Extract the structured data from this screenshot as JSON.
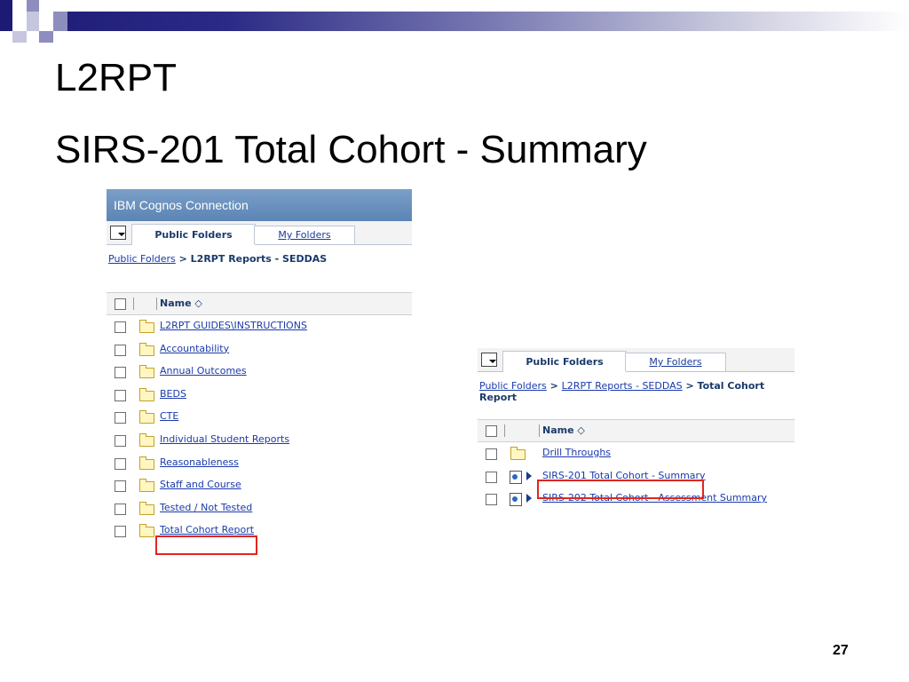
{
  "slide": {
    "title": "L2RPT",
    "subtitle": "SIRS-201 Total Cohort - Summary",
    "page_number": "27"
  },
  "colors": {
    "band_dark": "#1c1a74",
    "link": "#1a3aaa",
    "highlight": "#e0261e"
  },
  "screenshot1": {
    "app_title": "IBM Cognos Connection",
    "tabs": {
      "active": "Public Folders",
      "other": "My Folders"
    },
    "breadcrumb": {
      "link": "Public Folders",
      "separator": " > ",
      "current": "L2RPT Reports - SEDDAS"
    },
    "column_header": "Name ◇",
    "items": [
      "L2RPT GUIDES\\INSTRUCTIONS",
      "Accountability",
      "Annual Outcomes",
      "BEDS",
      "CTE",
      "Individual Student Reports",
      "Reasonableness",
      "Staff and Course",
      "Tested / Not Tested",
      "Total Cohort Report"
    ]
  },
  "screenshot2": {
    "tabs": {
      "active": "Public Folders",
      "other": "My Folders"
    },
    "breadcrumb": {
      "link1": "Public Folders",
      "separator": " > ",
      "link2": "L2RPT Reports - SEDDAS",
      "current": "Total Cohort Report"
    },
    "column_header": "Name ◇",
    "items": [
      "Drill Throughs",
      "SIRS-201 Total Cohort - Summary",
      "SIRS-202 Total Cohort - Assessment Summary"
    ]
  }
}
